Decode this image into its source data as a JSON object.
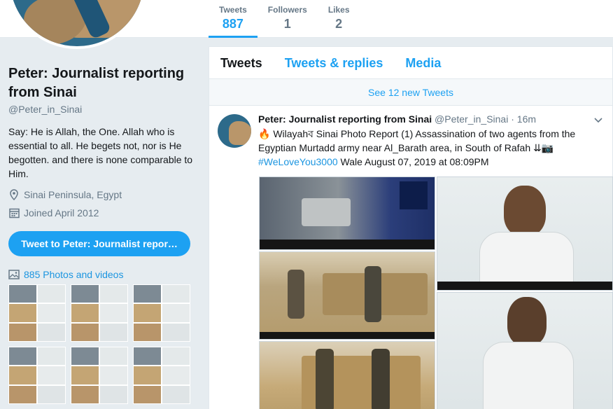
{
  "stats": [
    {
      "label": "Tweets",
      "value": "887"
    },
    {
      "label": "Followers",
      "value": "1"
    },
    {
      "label": "Likes",
      "value": "2"
    }
  ],
  "profile": {
    "name": "Peter: Journalist reporting from Sinai",
    "handle": "@Peter_in_Sinai",
    "bio": "Say: He is Allah, the One. Allah who is essential to all. He begets not, nor is He begotten. and there is none comparable to Him.",
    "location": "Sinai Peninsula, Egypt",
    "joined": "Joined April 2012",
    "tweet_to_label": "Tweet to Peter: Journalist repor…",
    "photos_label": "885 Photos and videos"
  },
  "tabs": [
    {
      "label": "Tweets"
    },
    {
      "label": "Tweets & replies"
    },
    {
      "label": "Media"
    }
  ],
  "new_tweets_label": "See 12 new Tweets",
  "tweet": {
    "name": "Peter: Journalist reporting from Sinai",
    "handle": "@Peter_in_Sinai",
    "sep": " · ",
    "time": "16m",
    "text_main": "🔥 Wilayahব Sinai Photo Report (1) Assassination of two agents from the Egyptian Murtadd army near Al_Barath area, in South of Rafah ⇊📷",
    "hashtag": "#WeLoveYou3000",
    "text_tail": " Wale  August 07, 2019 at 08:09PM"
  },
  "colors": {
    "accent": "#1da1f2",
    "link": "#1b95e0",
    "muted": "#657786",
    "page_bg": "#e6ecf0"
  },
  "icons": {
    "location": "location-pin-icon",
    "calendar": "calendar-icon",
    "photos": "photo-icon",
    "chevron": "chevron-down-icon"
  }
}
